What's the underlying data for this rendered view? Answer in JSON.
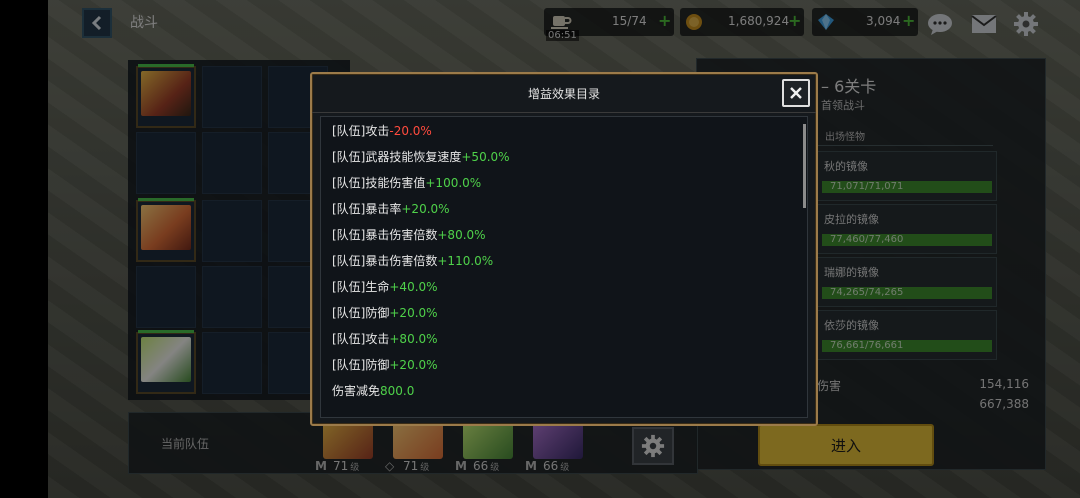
{
  "topbar": {
    "title": "战斗",
    "stamina": {
      "value": "15/74",
      "timer": "06:51"
    },
    "gold": "1,680,924",
    "gems": "3,094"
  },
  "stage_info": {
    "title": "– 6关卡",
    "subtitle": "首领战斗",
    "tab": "出场怪物",
    "monsters": [
      {
        "name": "秋的镜像",
        "hp": "71,071/71,071",
        "fill": 1.0
      },
      {
        "name": "皮拉的镜像",
        "hp": "77,460/77,460",
        "fill": 1.0
      },
      {
        "name": "瑞娜的镜像",
        "hp": "74,265/74,265",
        "fill": 1.0
      },
      {
        "name": "依莎的镜像",
        "hp": "76,661/76,661",
        "fill": 1.0
      }
    ],
    "stats": [
      {
        "label": "伤害",
        "value": "154,116"
      },
      {
        "label": "",
        "value": "667,388"
      }
    ],
    "enter_label": "进入"
  },
  "team": {
    "label": "当前队伍",
    "members": [
      {
        "level": "71",
        "unit": "级",
        "mark": "M"
      },
      {
        "level": "71",
        "unit": "级",
        "mark": "◇"
      },
      {
        "level": "66",
        "unit": "级",
        "mark": "M"
      },
      {
        "level": "66",
        "unit": "级",
        "mark": "M"
      }
    ]
  },
  "modal": {
    "title": "增益效果目录",
    "close_label": "✕",
    "buffs": [
      {
        "prefix": "[队伍]攻击",
        "value": "-20.0%",
        "sign": "neg"
      },
      {
        "prefix": "[队伍]武器技能恢复速度",
        "value": "+50.0%",
        "sign": "pos"
      },
      {
        "prefix": "[队伍]技能伤害值",
        "value": "+100.0%",
        "sign": "pos"
      },
      {
        "prefix": "[队伍]暴击率",
        "value": "+20.0%",
        "sign": "pos"
      },
      {
        "prefix": "[队伍]暴击伤害倍数",
        "value": "+80.0%",
        "sign": "pos"
      },
      {
        "prefix": "[队伍]暴击伤害倍数",
        "value": "+110.0%",
        "sign": "pos"
      },
      {
        "prefix": "[队伍]生命",
        "value": "+40.0%",
        "sign": "pos"
      },
      {
        "prefix": "[队伍]防御",
        "value": "+20.0%",
        "sign": "pos"
      },
      {
        "prefix": "[队伍]攻击",
        "value": "+80.0%",
        "sign": "pos"
      },
      {
        "prefix": "[队伍]防御",
        "value": "+20.0%",
        "sign": "pos"
      },
      {
        "prefix": "伤害减免",
        "value": "800.0",
        "sign": "pos"
      }
    ]
  },
  "colors": {
    "positive": "#4fd24a",
    "negative": "#ff4b3e",
    "enter_button": "#e8c23a",
    "modal_border": "#9c7b4a"
  },
  "icons": {
    "back": "chevron-left-icon",
    "stamina": "coffee-cup-icon",
    "gold": "coin-icon",
    "gems": "diamond-icon",
    "chat": "chat-bubble-icon",
    "mail": "mail-icon",
    "settings": "gear-icon",
    "close": "close-icon"
  }
}
